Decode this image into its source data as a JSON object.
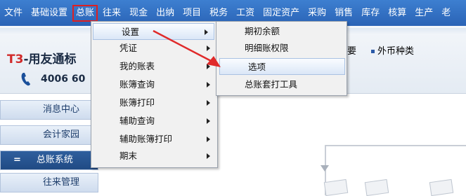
{
  "menubar": {
    "items": [
      "文件",
      "基础设置",
      "总账",
      "往来",
      "现金",
      "出纳",
      "项目",
      "税务",
      "工资",
      "固定资产",
      "采购",
      "销售",
      "库存",
      "核算",
      "生产",
      "老"
    ]
  },
  "header": {
    "logo_prefix": "T3",
    "logo_text": "-用友通标",
    "phone": "4006 60",
    "toolbar_item1": "要",
    "toolbar_item2": "外币种类"
  },
  "nav": {
    "items": [
      "消息中心",
      "会计家园",
      "总账系统",
      "往来管理"
    ],
    "active_icon": "="
  },
  "menu_zongzhang": {
    "items": [
      "设置",
      "凭证",
      "我的账表",
      "账簿查询",
      "账簿打印",
      "辅助查询",
      "辅助账簿打印",
      "期末"
    ]
  },
  "menu_shezhi": {
    "items": [
      "期初余额",
      "明细账权限",
      "选项",
      "总账套打工具"
    ]
  },
  "colors": {
    "menubar": "#2f6cc0",
    "highlight_border": "#e02020",
    "nav_active": "#2a558f"
  }
}
